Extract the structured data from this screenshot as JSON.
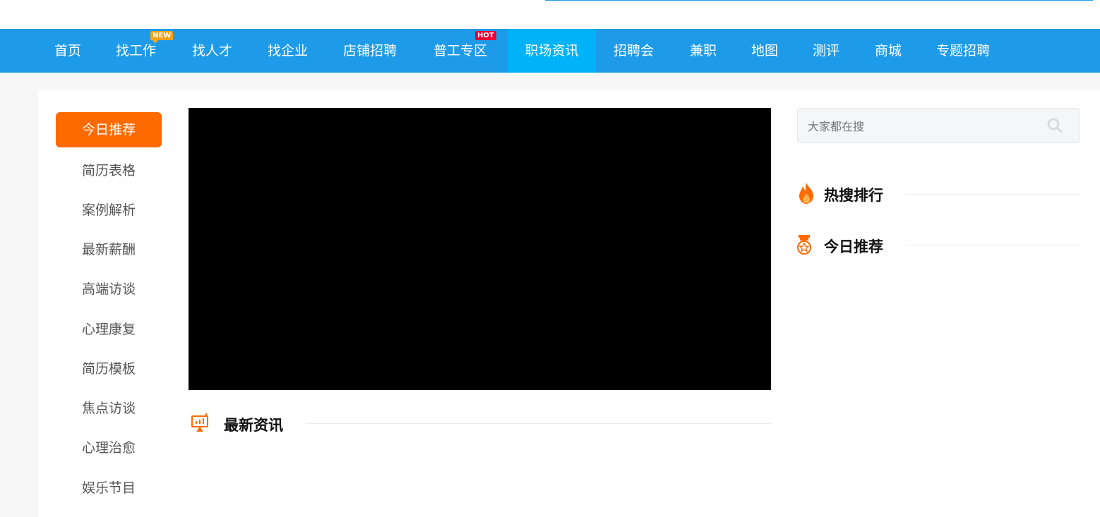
{
  "nav": {
    "items": [
      {
        "label": "首页"
      },
      {
        "label": "找工作",
        "badge": "NEW"
      },
      {
        "label": "找人才"
      },
      {
        "label": "找企业"
      },
      {
        "label": "店铺招聘"
      },
      {
        "label": "普工专区",
        "badge": "HOT"
      },
      {
        "label": "职场资讯",
        "active": true
      },
      {
        "label": "招聘会"
      },
      {
        "label": "兼职"
      },
      {
        "label": "地图"
      },
      {
        "label": "测评"
      },
      {
        "label": "商城"
      },
      {
        "label": "专题招聘"
      }
    ]
  },
  "sidebar": {
    "items": [
      {
        "label": "今日推荐",
        "active": true
      },
      {
        "label": "简历表格"
      },
      {
        "label": "案例解析"
      },
      {
        "label": "最新薪酬"
      },
      {
        "label": "高端访谈"
      },
      {
        "label": "心理康复"
      },
      {
        "label": "简历模板"
      },
      {
        "label": "焦点访谈"
      },
      {
        "label": "心理治愈"
      },
      {
        "label": "娱乐节目"
      }
    ]
  },
  "main": {
    "latest_title": "最新资讯"
  },
  "right": {
    "search": {
      "placeholder": "大家都在搜"
    },
    "hot_title": "热搜排行",
    "recommend_title": "今日推荐"
  },
  "colors": {
    "nav_bg": "#1e9be8",
    "nav_active": "#00b2f8",
    "accent_orange": "#ff6a00",
    "badge_new": "#f7a21a",
    "badge_hot": "#e60033"
  }
}
